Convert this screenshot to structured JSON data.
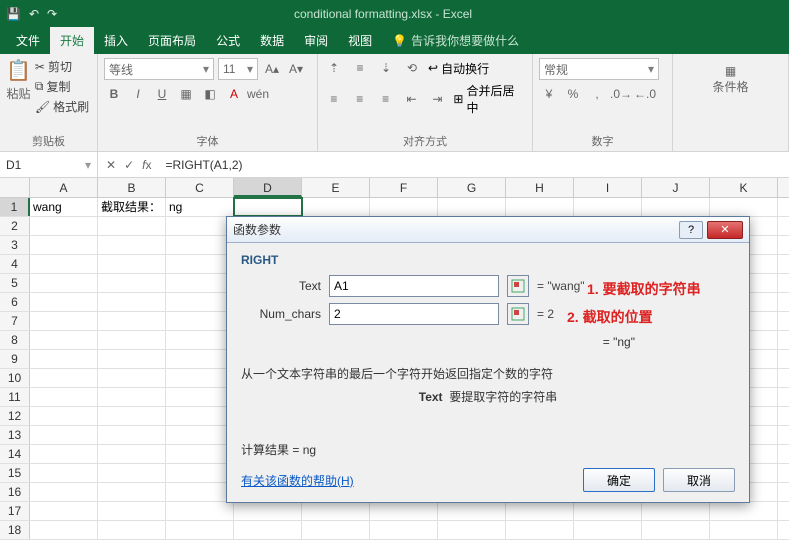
{
  "title": "conditional formatting.xlsx - Excel",
  "qat": {
    "save": "💾",
    "undo": "↶",
    "redo": "↷"
  },
  "tabs": [
    "文件",
    "开始",
    "插入",
    "页面布局",
    "公式",
    "数据",
    "审阅",
    "视图"
  ],
  "active_tab": 1,
  "tellme": "告诉我你想要做什么",
  "ribbon": {
    "clipboard": {
      "paste": "粘贴",
      "cut": "剪切",
      "copy": "复制",
      "painter": "格式刷",
      "label": "剪贴板"
    },
    "font": {
      "name": "等线",
      "size": "11",
      "label": "字体"
    },
    "align": {
      "wrap": "自动换行",
      "merge": "合并后居中",
      "label": "对齐方式"
    },
    "number": {
      "format": "常规",
      "label": "数字"
    },
    "styles": {
      "cond": "条件格"
    }
  },
  "namebox": "D1",
  "formula": "=RIGHT(A1,2)",
  "columns": [
    "A",
    "B",
    "C",
    "D",
    "E",
    "F",
    "G",
    "H",
    "I",
    "J",
    "K"
  ],
  "cells": {
    "A1": "wang",
    "B1": "截取结果：",
    "C1": "ng"
  },
  "dialog": {
    "title": "函数参数",
    "fn": "RIGHT",
    "args": [
      {
        "label": "Text",
        "value": "A1",
        "result": "\"wang\""
      },
      {
        "label": "Num_chars",
        "value": "2",
        "result": "2"
      }
    ],
    "eq": "= ",
    "overall_result": "\"ng\"",
    "desc": "从一个文本字符串的最后一个字符开始返回指定个数的字符",
    "argdesc_label": "Text",
    "argdesc": "要提取字符的字符串",
    "calc_label": "计算结果 = ",
    "calc_result": "ng",
    "help": "有关该函数的帮助(H)",
    "ok": "确定",
    "cancel": "取消"
  },
  "annotations": {
    "a1": "1. 要截取的字符串",
    "a2": "2. 截取的位置"
  }
}
